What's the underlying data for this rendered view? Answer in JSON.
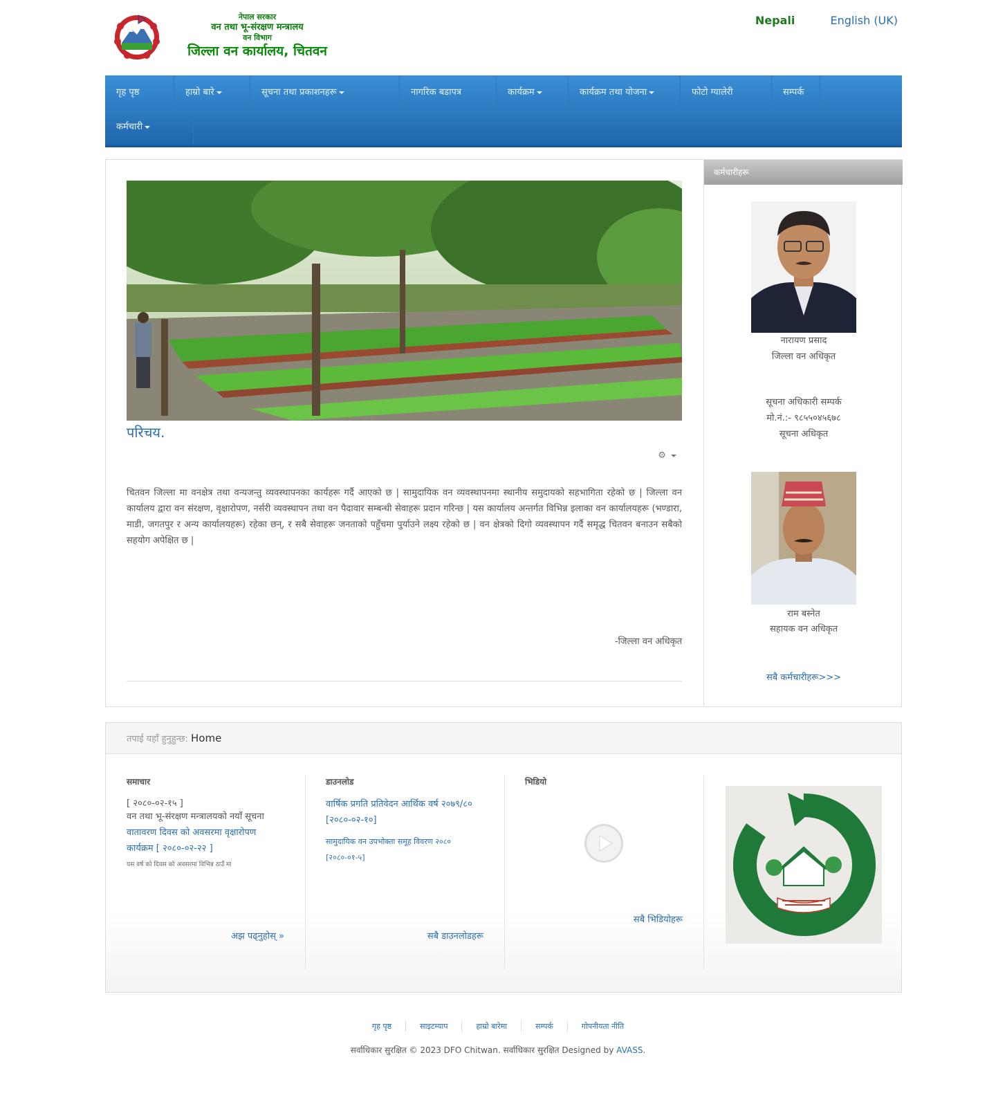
{
  "header": {
    "logo_line1": "नेपाल सरकार",
    "logo_line2": "वन तथा भू-संरक्षण मन्त्रालय",
    "logo_line3": "वन विभाग",
    "logo_line4": "जिल्ला वन कार्यालय, चितवन",
    "lang_nepali": "Nepali",
    "lang_english": "English (UK)"
  },
  "nav": {
    "items": [
      {
        "label": "गृह पृष्ठ",
        "caret": false
      },
      {
        "label": "हाम्रो बारे",
        "caret": true
      },
      {
        "label": "सूचना तथा प्रकाशनहरू",
        "caret": true
      },
      {
        "label": "नागरिक बडापत्र",
        "caret": false
      },
      {
        "label": "कार्यक्रम",
        "caret": true
      },
      {
        "label": "कार्यक्रम तथा योजना",
        "caret": true
      },
      {
        "label": "फोटो ग्यालेरी",
        "caret": false
      },
      {
        "label": "सम्पर्क",
        "caret": false
      },
      {
        "label": "कर्मचारी",
        "caret": true
      }
    ]
  },
  "article": {
    "title": "परिचय.",
    "body": "चितवन जिल्ला मा वनक्षेत्र तथा वन्यजन्तु व्यवस्थापनका कार्यहरू गर्दै आएको छ | सामुदायिक वन व्यवस्थापनमा स्थानीय समुदायको सहभागिता रहेको छ | जिल्ला वन कार्यालय द्वारा वन संरक्षण, वृक्षारोपण, नर्सरी व्यवस्थापन तथा वन पैदावार सम्बन्धी सेवाहरू प्रदान गरिन्छ | यस कार्यालय अन्तर्गत विभिन्न इलाका वन कार्यालयहरू (भण्डारा, माडी, जगतपुर र अन्य कार्यालयहरू) रहेका छन्, र सबै सेवाहरू जनताको पहुँचमा पुर्याउने लक्ष्य रहेको छ | वन क्षेत्रको दिगो व्यवस्थापन गर्दै समृद्ध चितवन बनाउन सबैको सहयोग अपेक्षित छ |",
    "signature": "-जिल्ला वन अधिकृत"
  },
  "sidebar": {
    "heading": "कर्मचारीहरू",
    "person1_name": "नारायण प्रसाद",
    "person1_role": "जिल्ला वन अधिकृत",
    "info_line1": "सूचना अधिकारी सम्पर्क",
    "info_line2": "मो.नं.:- ९८५५०४५६७८",
    "info_line3": "सूचना अधिकृत",
    "person2_name": "राम बस्नेत",
    "person2_role": "सहायक वन अधिकृत",
    "more": "सबै कर्मचारीहरू>>>"
  },
  "breadcrumb": {
    "label": "तपाई यहाँ हुनुहुन्छ:",
    "current": "Home"
  },
  "news": {
    "title": "समाचार",
    "date1": "[ २०८०-०२-१५ ]",
    "item1": "वन तथा भू-संरक्षण मन्त्रालयको नयाँ सूचना",
    "link2": "वातावरण दिवस को अवसरमा वृक्षारोपण कार्यक्रम [ २०८०-०२-२२ ]",
    "tiny": "यस वर्ष को दिवस को अवसरमा विभिन्न ठाउँ मा",
    "more": "अझ पढ्नुहोस् »"
  },
  "downloads": {
    "title": "डाउनलोड",
    "link1": "वार्षिक प्रगति प्रतिवेदन आर्थिक वर्ष २०७९/८० [२०८०-०२-१०]",
    "link2": "सामुदायिक वन उपभोक्ता समूह विवरण २०८० [२०८०-०१-५]",
    "more": "सबै डाउनलोडहरू"
  },
  "video": {
    "title": "भिडियो",
    "more": "सबै भिडियोहरू"
  },
  "footer": {
    "links": [
      "गृह पृष्ठ",
      "साइटम्याप",
      "हाम्रो बारेमा",
      "सम्पर्क",
      "गोपनीयता नीति"
    ],
    "copyright_prefix": "सर्वाधिकार सुरक्षित © 2023 DFO Chitwan. सर्वाधिकार सुरक्षित Designed by",
    "designer": "AVASS"
  },
  "colors": {
    "nav_blue": "#2a7bc4",
    "link_blue": "#2a6eb1",
    "logo_green": "#0b7b0b"
  }
}
